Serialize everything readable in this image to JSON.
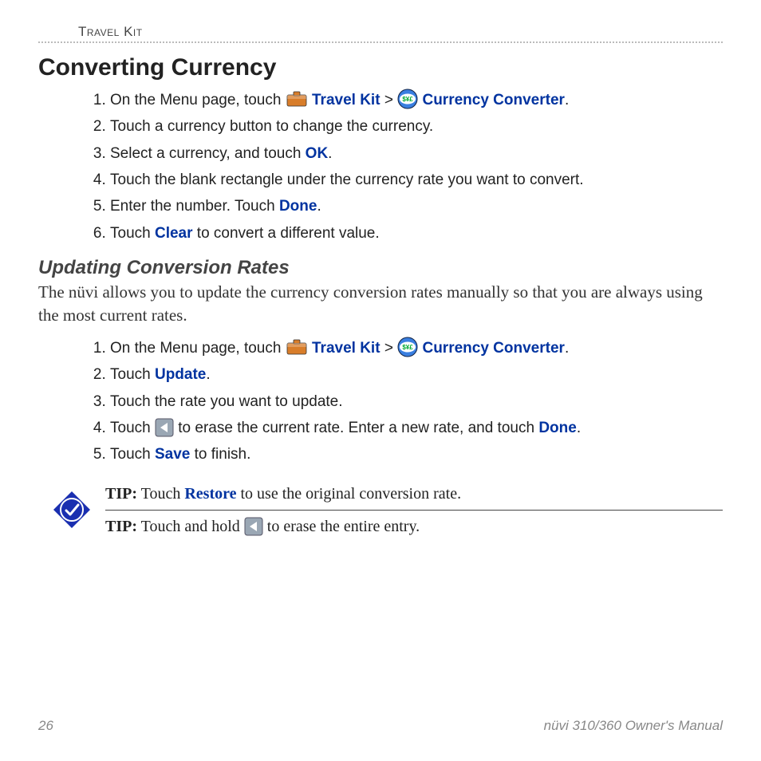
{
  "header": {
    "section": "Travel Kit"
  },
  "h1": "Converting Currency",
  "steps1": [
    {
      "pre": "On the Menu page, touch ",
      "tk": "Travel Kit",
      "sep": " > ",
      "cc": "Currency Converter",
      "post": "."
    },
    {
      "text": "Touch a currency button to change the currency."
    },
    {
      "pre": "Select a currency, and touch ",
      "em": "OK",
      "post": "."
    },
    {
      "text": "Touch the blank rectangle under the currency rate you want to convert."
    },
    {
      "pre": "Enter the number. Touch ",
      "em": "Done",
      "post": "."
    },
    {
      "pre": "Touch ",
      "em": "Clear",
      "post": " to convert a different value."
    }
  ],
  "subhead": "Updating Conversion Rates",
  "para": "The nüvi allows you to update the currency conversion rates manually so that you are always using the most current rates.",
  "steps2": [
    {
      "pre": "On the Menu page, touch ",
      "tk": "Travel Kit",
      "sep": " > ",
      "cc": "Currency Converter",
      "post": "."
    },
    {
      "pre": "Touch ",
      "em": "Update",
      "post": "."
    },
    {
      "text": "Touch the rate you want to update."
    },
    {
      "pre": "Touch ",
      "back": true,
      "mid": " to erase the current rate. Enter a new rate, and touch ",
      "em": "Done",
      "post": "."
    },
    {
      "pre": "Touch ",
      "em": "Save",
      "post": " to finish."
    }
  ],
  "tips": {
    "label": "TIP:",
    "tip1_pre": " Touch ",
    "tip1_em": "Restore",
    "tip1_post": " to use the original conversion rate.",
    "tip2_pre": " Touch and hold ",
    "tip2_post": " to erase the entire entry."
  },
  "footer": {
    "page": "26",
    "manual": "nüvi 310/360 Owner's Manual"
  }
}
